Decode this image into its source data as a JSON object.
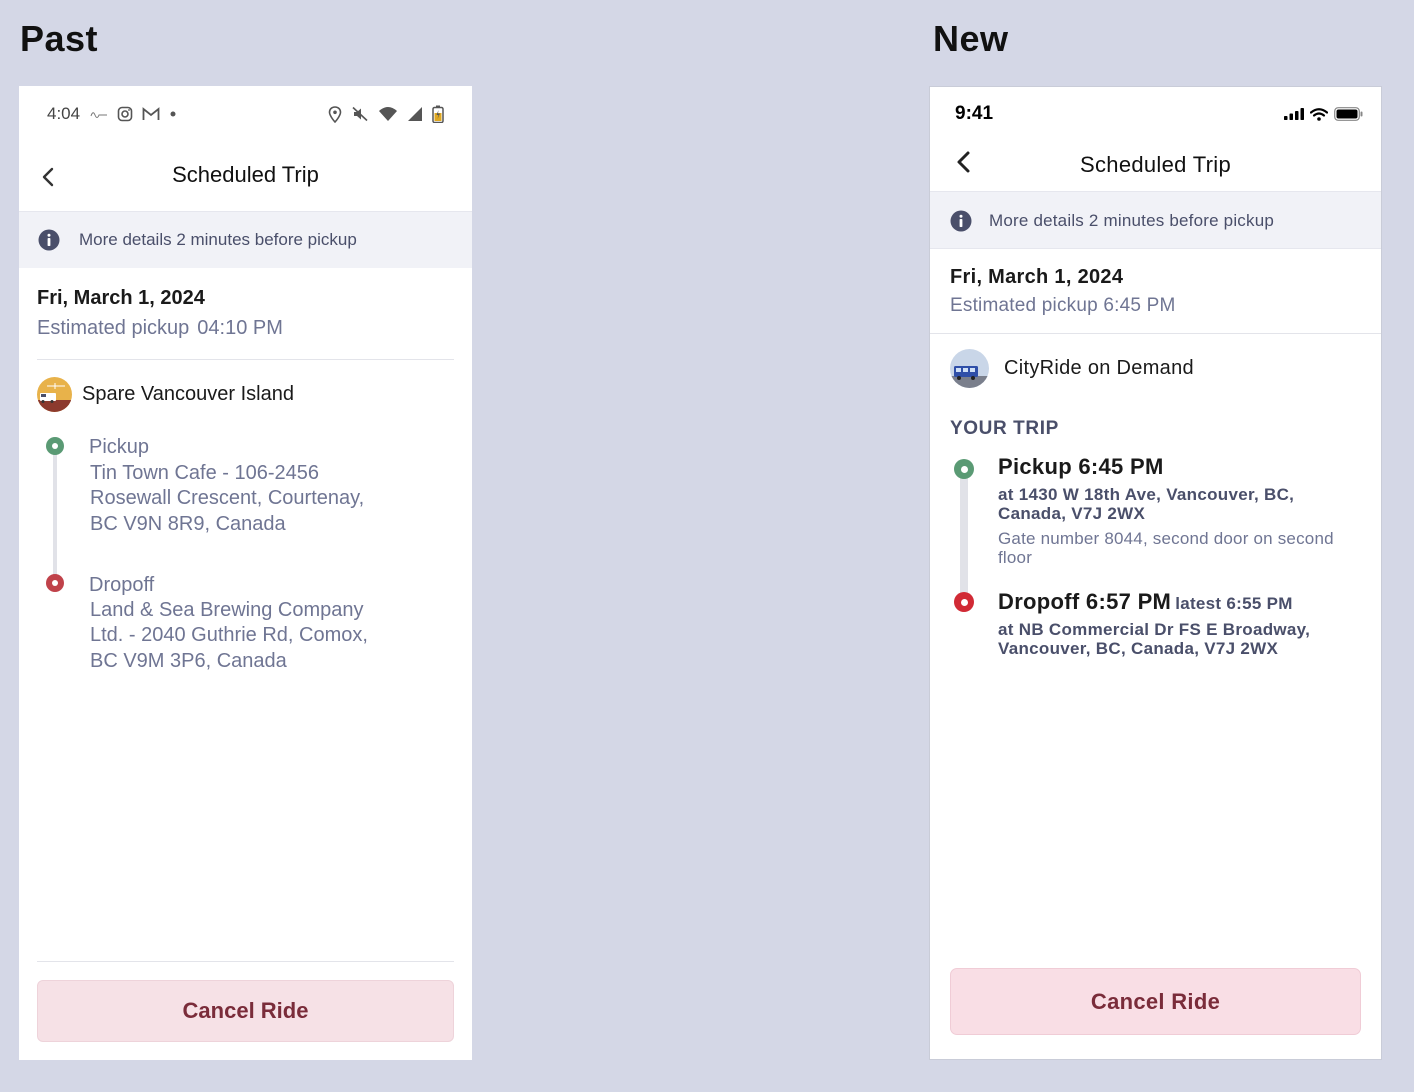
{
  "labels": {
    "past": "Past",
    "new": "New"
  },
  "colors": {
    "pickup_dot": "#5a9a74",
    "dropoff_dot_past": "#c0424a",
    "dropoff_dot_new": "#d12a35",
    "cancel_bg": "#f6e1e6",
    "cancel_text": "#7a2c3a",
    "banner_bg": "#f1f2f7",
    "muted_text": "#6f7593"
  },
  "past": {
    "status_bar": {
      "time": "4:04",
      "left_icons": [
        "signature-icon",
        "instagram-icon",
        "gmail-icon",
        "dot-icon"
      ],
      "right_icons": [
        "location-icon",
        "mute-icon",
        "wifi-icon",
        "signal-icon",
        "battery-icon"
      ]
    },
    "header": {
      "back_icon": "chevron-left-icon",
      "title": "Scheduled Trip"
    },
    "banner": {
      "icon": "info-icon",
      "text": "More details 2 minutes before pickup"
    },
    "trip": {
      "date": "Fri, March 1, 2024",
      "estimated_label": "Estimated pickup",
      "estimated_time": "04:10 PM"
    },
    "provider": {
      "name": "Spare Vancouver Island"
    },
    "stops": {
      "pickup": {
        "label": "Pickup",
        "address": "Tin Town Cafe - 106-2456 Rosewall Crescent, Courtenay, BC V9N 8R9, Canada"
      },
      "dropoff": {
        "label": "Dropoff",
        "address": "Land & Sea Brewing Company Ltd. - 2040 Guthrie Rd, Comox, BC V9M 3P6, Canada"
      }
    },
    "cancel_label": "Cancel Ride"
  },
  "new": {
    "status_bar": {
      "time": "9:41",
      "right_icons": [
        "cellular-signal-icon",
        "wifi-icon",
        "battery-icon"
      ]
    },
    "header": {
      "back_icon": "chevron-left-icon",
      "title": "Scheduled Trip"
    },
    "banner": {
      "icon": "info-icon",
      "text": "More details 2 minutes before pickup"
    },
    "trip": {
      "date": "Fri, March 1, 2024",
      "estimated_label": "Estimated pickup 6:45 PM"
    },
    "provider": {
      "name": "CityRide on Demand"
    },
    "section_title": "YOUR TRIP",
    "stops": {
      "pickup": {
        "heading": "Pickup 6:45 PM",
        "address": "at 1430 W 18th Ave, Vancouver, BC, Canada, V7J 2WX",
        "note": "Gate number 8044, second door on second floor"
      },
      "dropoff": {
        "heading": "Dropoff 6:57 PM",
        "latest": "latest 6:55 PM",
        "address": "at NB Commercial Dr FS E Broadway, Vancouver, BC, Canada, V7J 2WX"
      }
    },
    "cancel_label": "Cancel Ride"
  }
}
